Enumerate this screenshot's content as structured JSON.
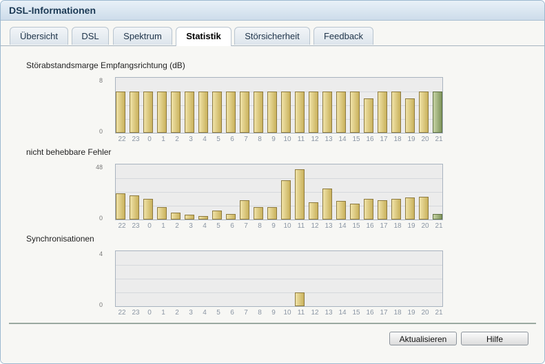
{
  "window": {
    "title": "DSL-Informationen"
  },
  "tabs": [
    {
      "label": "Übersicht",
      "active": false
    },
    {
      "label": "DSL",
      "active": false
    },
    {
      "label": "Spektrum",
      "active": false
    },
    {
      "label": "Statistik",
      "active": true
    },
    {
      "label": "Störsicherheit",
      "active": false
    },
    {
      "label": "Feedback",
      "active": false
    }
  ],
  "chart_data": [
    {
      "type": "bar",
      "title": "Störabstandsmarge Empfangsrichtung (dB)",
      "categories": [
        "22",
        "23",
        "0",
        "1",
        "2",
        "3",
        "4",
        "5",
        "6",
        "7",
        "8",
        "9",
        "10",
        "11",
        "12",
        "13",
        "14",
        "15",
        "16",
        "17",
        "18",
        "19",
        "20",
        "21"
      ],
      "values": [
        6,
        6,
        6,
        6,
        6,
        6,
        6,
        6,
        6,
        6,
        6,
        6,
        6,
        6,
        6,
        6,
        6,
        6,
        5,
        6,
        6,
        5,
        6,
        6
      ],
      "ylim": [
        0,
        8
      ],
      "yticks": [
        "8",
        "0"
      ],
      "grid": true
    },
    {
      "type": "bar",
      "title": "nicht behebbare Fehler",
      "categories": [
        "22",
        "23",
        "0",
        "1",
        "2",
        "3",
        "4",
        "5",
        "6",
        "7",
        "8",
        "9",
        "10",
        "11",
        "12",
        "13",
        "14",
        "15",
        "16",
        "17",
        "18",
        "19",
        "20",
        "21"
      ],
      "values": [
        23,
        21,
        18,
        11,
        6,
        4,
        3,
        8,
        5,
        17,
        11,
        11,
        34,
        44,
        15,
        27,
        16,
        14,
        18,
        17,
        18,
        19,
        20,
        5
      ],
      "ylim": [
        0,
        48
      ],
      "yticks": [
        "48",
        "0"
      ],
      "grid": true
    },
    {
      "type": "bar",
      "title": "Synchronisationen",
      "categories": [
        "22",
        "23",
        "0",
        "1",
        "2",
        "3",
        "4",
        "5",
        "6",
        "7",
        "8",
        "9",
        "10",
        "11",
        "12",
        "13",
        "14",
        "15",
        "16",
        "17",
        "18",
        "19",
        "20",
        "21"
      ],
      "values": [
        0,
        0,
        0,
        0,
        0,
        0,
        0,
        0,
        0,
        0,
        0,
        0,
        0,
        1,
        0,
        0,
        0,
        0,
        0,
        0,
        0,
        0,
        0,
        0
      ],
      "ylim": [
        0,
        4
      ],
      "yticks": [
        "4",
        "0"
      ],
      "grid": true
    }
  ],
  "buttons": {
    "refresh": "Aktualisieren",
    "help": "Hilfe"
  },
  "colors": {
    "bar": "#d9c67a",
    "bar_current": "#9aac74",
    "plot_bg": "#ececec",
    "title_bar": "#d6e3ef"
  }
}
